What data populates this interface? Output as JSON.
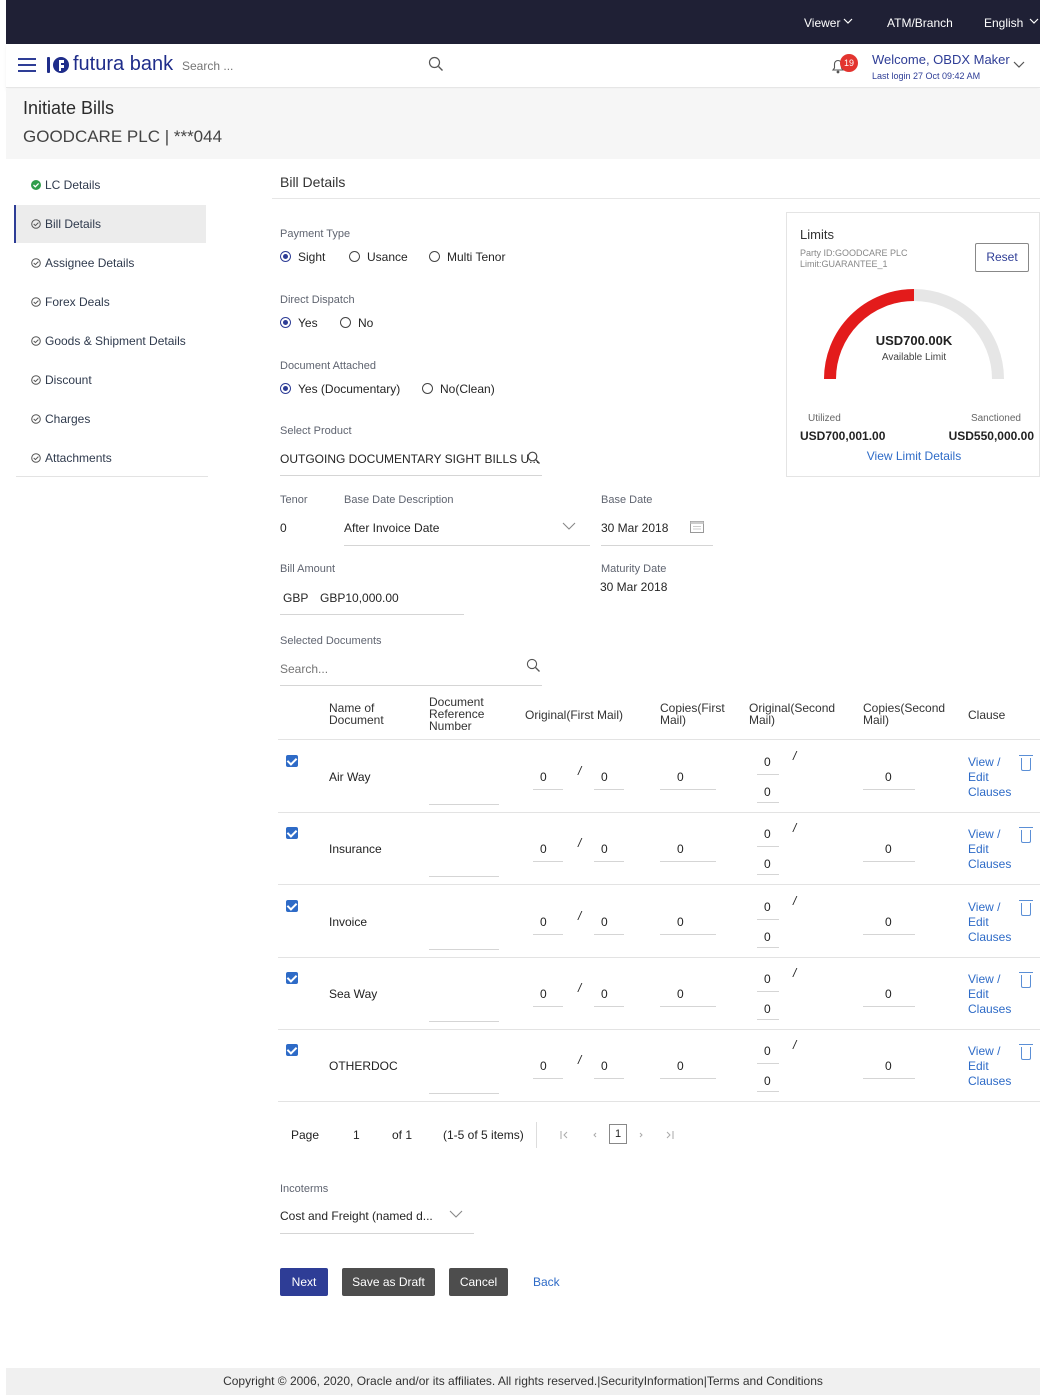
{
  "topbar": {
    "viewer": "Viewer",
    "atm": "ATM/Branch",
    "lang": "English"
  },
  "header": {
    "brand": "futura bank",
    "search_placeholder": "Search ...",
    "notif_count": "19",
    "welcome": "Welcome, OBDX Maker",
    "last_login": "Last login 27 Oct 09:42 AM"
  },
  "page": {
    "title": "Initiate Bills",
    "subtitle": "GOODCARE PLC | ***044"
  },
  "sidebar": {
    "items": [
      {
        "label": "LC Details"
      },
      {
        "label": "Bill Details"
      },
      {
        "label": "Assignee Details"
      },
      {
        "label": "Forex Deals"
      },
      {
        "label": "Goods & Shipment Details"
      },
      {
        "label": "Discount"
      },
      {
        "label": "Charges"
      },
      {
        "label": "Attachments"
      }
    ]
  },
  "form": {
    "section_title": "Bill Details",
    "payment_type": {
      "label": "Payment Type",
      "options": [
        "Sight",
        "Usance",
        "Multi Tenor"
      ],
      "selected": "Sight"
    },
    "direct_dispatch": {
      "label": "Direct Dispatch",
      "options": [
        "Yes",
        "No"
      ],
      "selected": "Yes"
    },
    "document_attached": {
      "label": "Document Attached",
      "options": [
        "Yes (Documentary)",
        "No(Clean)"
      ],
      "selected": "Yes (Documentary)"
    },
    "select_product": {
      "label": "Select Product",
      "value": "OUTGOING DOCUMENTARY SIGHT BILLS U..."
    },
    "tenor": {
      "label": "Tenor",
      "value": "0"
    },
    "base_date_desc": {
      "label": "Base Date Description",
      "value": "After Invoice Date"
    },
    "base_date": {
      "label": "Base Date",
      "value": "30 Mar 2018"
    },
    "bill_amount": {
      "label": "Bill Amount",
      "currency": "GBP",
      "value": "GBP10,000.00"
    },
    "maturity_date": {
      "label": "Maturity Date",
      "value": "30 Mar 2018"
    },
    "selected_documents": {
      "label": "Selected Documents",
      "search_placeholder": "Search..."
    },
    "incoterms": {
      "label": "Incoterms",
      "value": "Cost and Freight (named d..."
    }
  },
  "limits": {
    "title": "Limits",
    "party": "Party ID:GOODCARE PLC",
    "limit": "Limit:GUARANTEE_1",
    "reset": "Reset",
    "available_value": "USD700.00K",
    "available_label": "Available Limit",
    "available_fraction": 0.5,
    "utilized_label": "Utilized",
    "utilized_value": "USD700,001.00",
    "sanctioned_label": "Sanctioned",
    "sanctioned_value": "USD550,000.00",
    "view_link": "View Limit Details"
  },
  "table": {
    "headers": {
      "name": "Name of Document",
      "ref": "Document Reference Number",
      "orig1": "Original(First Mail)",
      "copies1": "Copies(First Mail)",
      "orig2": "Original(Second Mail)",
      "copies2": "Copies(Second Mail)",
      "clause": "Clause"
    },
    "rows": [
      {
        "name": "Air Way",
        "o1a": "0",
        "sep": "/",
        "o1b": "0",
        "c1": "0",
        "o2a": "0",
        "o2b": "0",
        "c2": "0",
        "view": "View /",
        "edit": "Edit",
        "clauses": "Clauses"
      },
      {
        "name": "Insurance",
        "o1a": "0",
        "sep": "/",
        "o1b": "0",
        "c1": "0",
        "o2a": "0",
        "o2b": "0",
        "c2": "0",
        "view": "View /",
        "edit": "Edit",
        "clauses": "Clauses"
      },
      {
        "name": "Invoice",
        "o1a": "0",
        "sep": "/",
        "o1b": "0",
        "c1": "0",
        "o2a": "0",
        "o2b": "0",
        "c2": "0",
        "view": "View /",
        "edit": "Edit",
        "clauses": "Clauses"
      },
      {
        "name": "Sea Way",
        "o1a": "0",
        "sep": "/",
        "o1b": "0",
        "c1": "0",
        "o2a": "0",
        "o2b": "0",
        "c2": "0",
        "view": "View /",
        "edit": "Edit",
        "clauses": "Clauses"
      },
      {
        "name": "OTHERDOC",
        "o1a": "0",
        "sep": "/",
        "o1b": "0",
        "c1": "0",
        "o2a": "0",
        "o2b": "0",
        "c2": "0",
        "view": "View /",
        "edit": "Edit",
        "clauses": "Clauses"
      }
    ],
    "pagination": {
      "page_label": "Page",
      "page": "1",
      "of": "of 1",
      "items": "(1-5 of 5 items)",
      "current": "1"
    }
  },
  "buttons": {
    "next": "Next",
    "draft": "Save as Draft",
    "cancel": "Cancel",
    "back": "Back"
  },
  "colors": {
    "primary": "#2e3d96",
    "gauge": "#e31b1b",
    "link": "#2e6bc7",
    "topbar": "#1f2035"
  },
  "footer": "Copyright © 2006, 2020, Oracle and/or its affiliates. All rights reserved.|SecurityInformation|Terms and Conditions"
}
